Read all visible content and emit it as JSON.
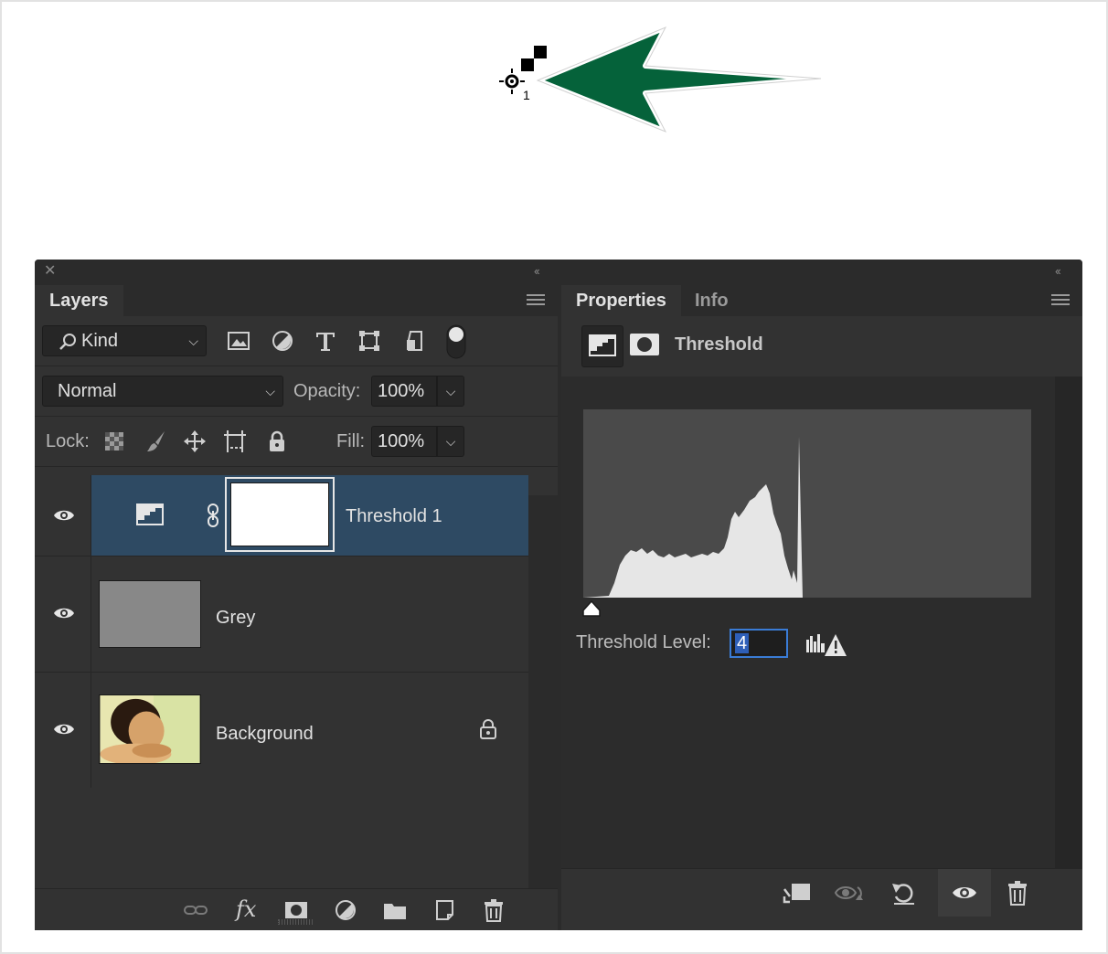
{
  "annotation": {
    "cursor_label": "1",
    "arrow_color": "#05623a"
  },
  "window": {
    "left_collapse": "‹‹",
    "right_collapse": "‹‹"
  },
  "layers_panel": {
    "tab": "Layers",
    "filter": {
      "kind_label": "Kind",
      "icons": [
        "image-filter-icon",
        "adjustment-filter-icon",
        "type-filter-icon",
        "shape-filter-icon",
        "smart-object-filter-icon",
        "filter-toggle-icon"
      ]
    },
    "blend_mode": "Normal",
    "opacity_label": "Opacity:",
    "opacity_value": "100%",
    "lock_label": "Lock:",
    "lock_icons": [
      "lock-transparent-icon",
      "lock-image-icon",
      "lock-position-icon",
      "lock-artboard-icon",
      "lock-all-icon"
    ],
    "fill_label": "Fill:",
    "fill_value": "100%",
    "layers": [
      {
        "name": "Threshold 1",
        "selected": true,
        "type": "adjustment"
      },
      {
        "name": "Grey",
        "selected": false,
        "type": "fill"
      },
      {
        "name": "Background",
        "selected": false,
        "type": "photo",
        "locked": true
      }
    ],
    "footer_icons": [
      "link-layers-icon",
      "fx-icon",
      "add-mask-icon",
      "new-adjustment-icon",
      "new-group-icon",
      "new-layer-icon",
      "delete-layer-icon"
    ],
    "footer_fx": "fx"
  },
  "properties_panel": {
    "tabs": [
      "Properties",
      "Info"
    ],
    "adjustment_title": "Threshold",
    "threshold_label": "Threshold Level:",
    "threshold_value": "4",
    "footer_icons": [
      "clip-to-layer-icon",
      "view-previous-state-icon",
      "reset-icon",
      "visibility-icon",
      "delete-icon"
    ]
  },
  "colors": {
    "panel": "#323232",
    "selected_row": "#2e4a63",
    "accent_blue": "#3a7cd6"
  }
}
